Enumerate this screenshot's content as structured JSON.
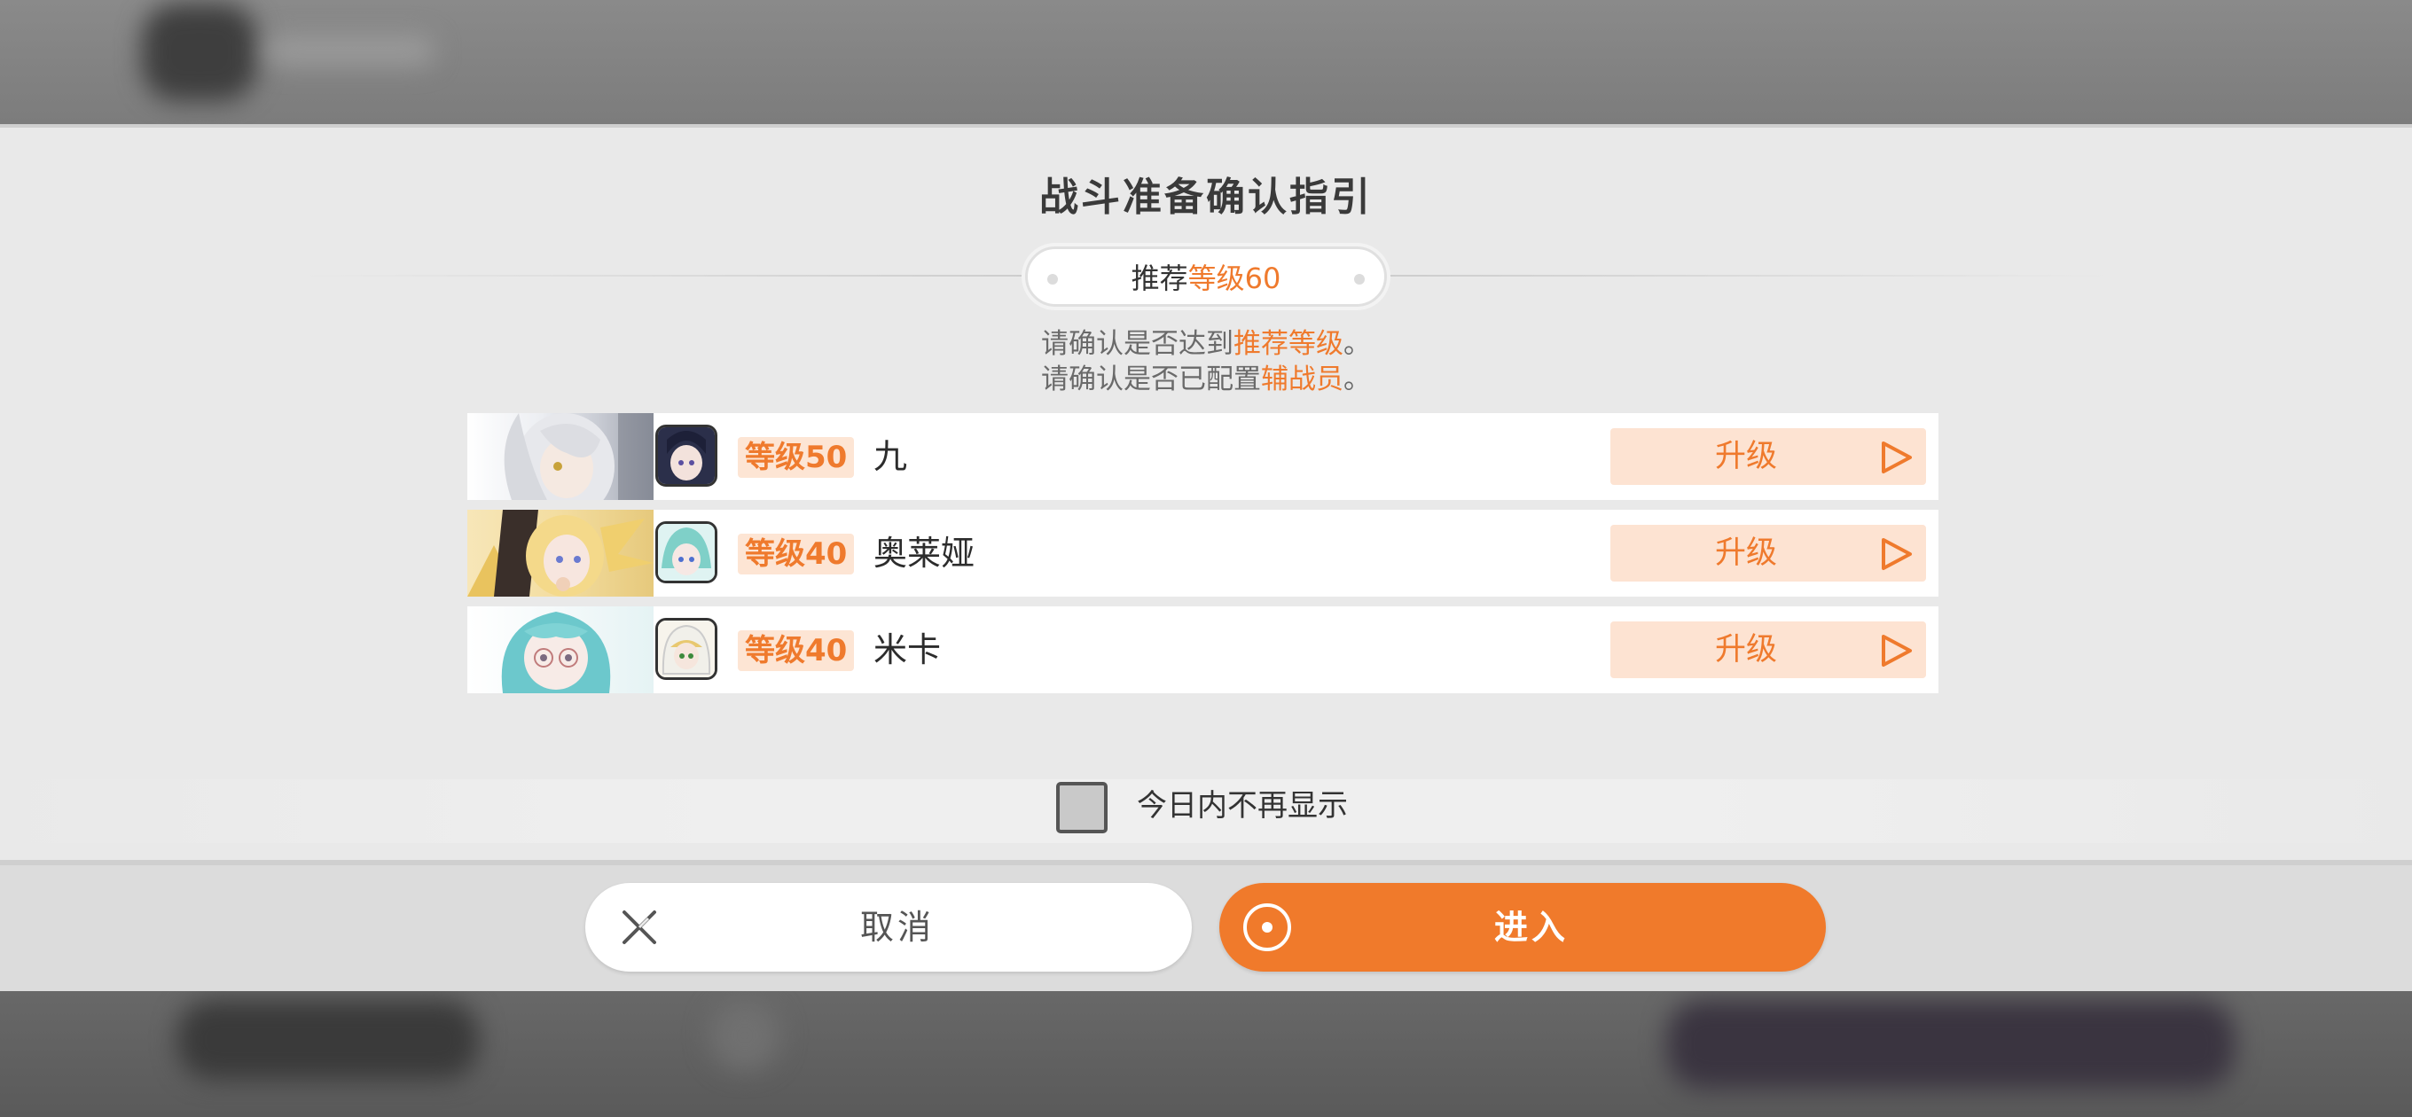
{
  "dialog": {
    "title": "战斗准备确认指引",
    "recommend": {
      "prefix": "推荐",
      "level": "等级60"
    },
    "notice_line1": {
      "prefix": "请确认是否达到",
      "highlight": "推荐等级",
      "suffix": "。"
    },
    "notice_line2": {
      "prefix": "请确认是否已配置",
      "highlight": "辅战员",
      "suffix": "。"
    }
  },
  "characters": [
    {
      "level": "等级50",
      "name": "九",
      "upgrade_label": "升级"
    },
    {
      "level": "等级40",
      "name": "奥莱娅",
      "upgrade_label": "升级"
    },
    {
      "level": "等级40",
      "name": "米卡",
      "upgrade_label": "升级"
    }
  ],
  "dont_show_today": {
    "label": "今日内不再显示",
    "checked": false
  },
  "buttons": {
    "cancel": "取消",
    "enter": "进入"
  },
  "colors": {
    "accent": "#ef7a2d",
    "accent_light": "#fde3d2",
    "panel": "#e9e9e9"
  }
}
